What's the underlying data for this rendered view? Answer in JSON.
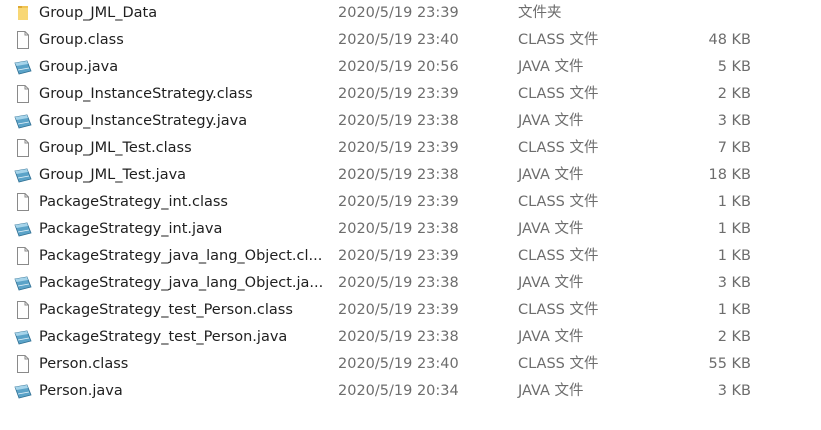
{
  "files": [
    {
      "name": "Group_JML_Data",
      "date": "2020/5/19 23:39",
      "type": "文件夹",
      "size": "",
      "icon": "folder-icon"
    },
    {
      "name": "Group.class",
      "date": "2020/5/19 23:40",
      "type": "CLASS 文件",
      "size": "48 KB",
      "icon": "file-icon"
    },
    {
      "name": "Group.java",
      "date": "2020/5/19 20:56",
      "type": "JAVA 文件",
      "size": "5 KB",
      "icon": "java-file-icon"
    },
    {
      "name": "Group_InstanceStrategy.class",
      "date": "2020/5/19 23:39",
      "type": "CLASS 文件",
      "size": "2 KB",
      "icon": "file-icon"
    },
    {
      "name": "Group_InstanceStrategy.java",
      "date": "2020/5/19 23:38",
      "type": "JAVA 文件",
      "size": "3 KB",
      "icon": "java-file-icon"
    },
    {
      "name": "Group_JML_Test.class",
      "date": "2020/5/19 23:39",
      "type": "CLASS 文件",
      "size": "7 KB",
      "icon": "file-icon"
    },
    {
      "name": "Group_JML_Test.java",
      "date": "2020/5/19 23:38",
      "type": "JAVA 文件",
      "size": "18 KB",
      "icon": "java-file-icon"
    },
    {
      "name": "PackageStrategy_int.class",
      "date": "2020/5/19 23:39",
      "type": "CLASS 文件",
      "size": "1 KB",
      "icon": "file-icon"
    },
    {
      "name": "PackageStrategy_int.java",
      "date": "2020/5/19 23:38",
      "type": "JAVA 文件",
      "size": "1 KB",
      "icon": "java-file-icon"
    },
    {
      "name": "PackageStrategy_java_lang_Object.cl...",
      "date": "2020/5/19 23:39",
      "type": "CLASS 文件",
      "size": "1 KB",
      "icon": "file-icon"
    },
    {
      "name": "PackageStrategy_java_lang_Object.ja...",
      "date": "2020/5/19 23:38",
      "type": "JAVA 文件",
      "size": "3 KB",
      "icon": "java-file-icon"
    },
    {
      "name": "PackageStrategy_test_Person.class",
      "date": "2020/5/19 23:39",
      "type": "CLASS 文件",
      "size": "1 KB",
      "icon": "file-icon"
    },
    {
      "name": "PackageStrategy_test_Person.java",
      "date": "2020/5/19 23:38",
      "type": "JAVA 文件",
      "size": "2 KB",
      "icon": "java-file-icon"
    },
    {
      "name": "Person.class",
      "date": "2020/5/19 23:40",
      "type": "CLASS 文件",
      "size": "55 KB",
      "icon": "file-icon"
    },
    {
      "name": "Person.java",
      "date": "2020/5/19 20:34",
      "type": "JAVA 文件",
      "size": "3 KB",
      "icon": "java-file-icon"
    }
  ]
}
